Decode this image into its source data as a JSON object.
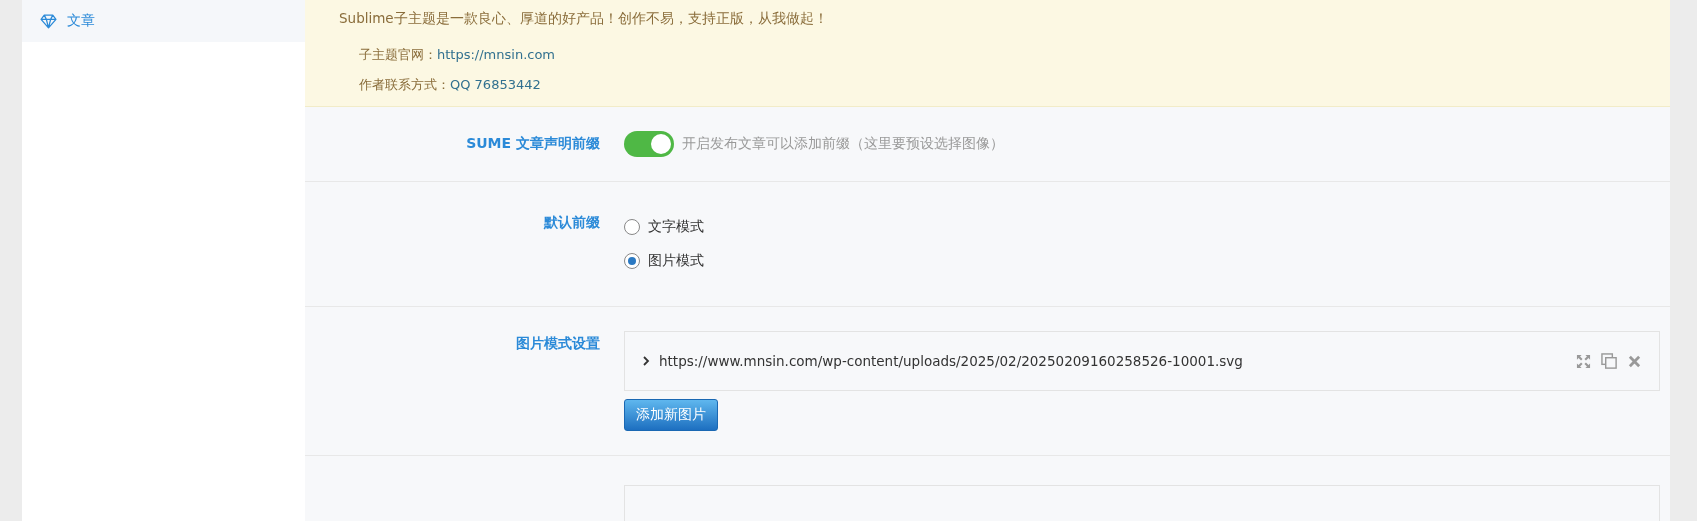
{
  "sidebar": {
    "items": [
      {
        "label": "文章",
        "selected": true
      }
    ]
  },
  "notice": {
    "intro": "Sublime子主题是一款良心、厚道的好产品！创作不易，支持正版，从我做起！",
    "lines": [
      {
        "label": "子主题官网：",
        "value": "https://mnsin.com"
      },
      {
        "label": "作者联系方式：",
        "value": "QQ 76853442"
      }
    ]
  },
  "settings": [
    {
      "kind": "switch",
      "label": "SUME 文章声明前缀",
      "on": true,
      "description": "开启发布文章可以添加前缀（这里要预设选择图像）"
    },
    {
      "kind": "radio",
      "label": "默认前缀",
      "options": [
        {
          "label": "文字模式",
          "selected": false
        },
        {
          "label": "图片模式",
          "selected": true
        }
      ]
    },
    {
      "kind": "repeater",
      "label": "图片模式设置",
      "items": [
        {
          "title": "https://www.mnsin.com/wp-content/uploads/2025/02/20250209160258526-10001.svg",
          "expanded": false
        }
      ],
      "add_button": "添加新图片"
    },
    {
      "kind": "partial"
    }
  ]
}
